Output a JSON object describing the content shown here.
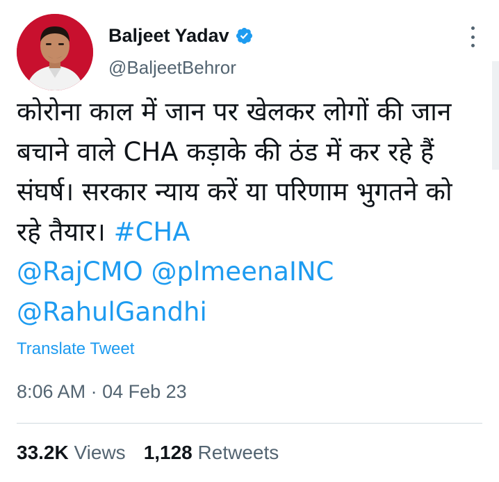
{
  "author": {
    "name": "Baljeet Yadav",
    "handle": "@BaljeetBehror",
    "verified": true
  },
  "tweet": {
    "text_plain": "कोरोना काल में जान पर खेलकर लोगों की जान बचाने वाले CHA कड़ाके की ठंड में कर रहे हैं संघर्ष। सरकार न्याय करें या परिणाम भुगतने को रहे तैयार। ",
    "hashtag": "#CHA",
    "mention_1": "@RajCMO",
    "mention_2": "@plmeenaINC",
    "mention_3": "@RahulGandhi"
  },
  "translate_label": "Translate Tweet",
  "timestamp": {
    "time": "8:06 AM",
    "separator": "·",
    "date": "04 Feb 23"
  },
  "stats": {
    "views_count": "33.2K",
    "views_label": "Views",
    "retweets_count": "1,128",
    "retweets_label": "Retweets"
  },
  "colors": {
    "link": "#1d9bf0",
    "secondary_text": "#536471",
    "primary_text": "#0f1419"
  },
  "icons": {
    "verified": "verified-badge-icon",
    "more": "more-options-icon"
  }
}
